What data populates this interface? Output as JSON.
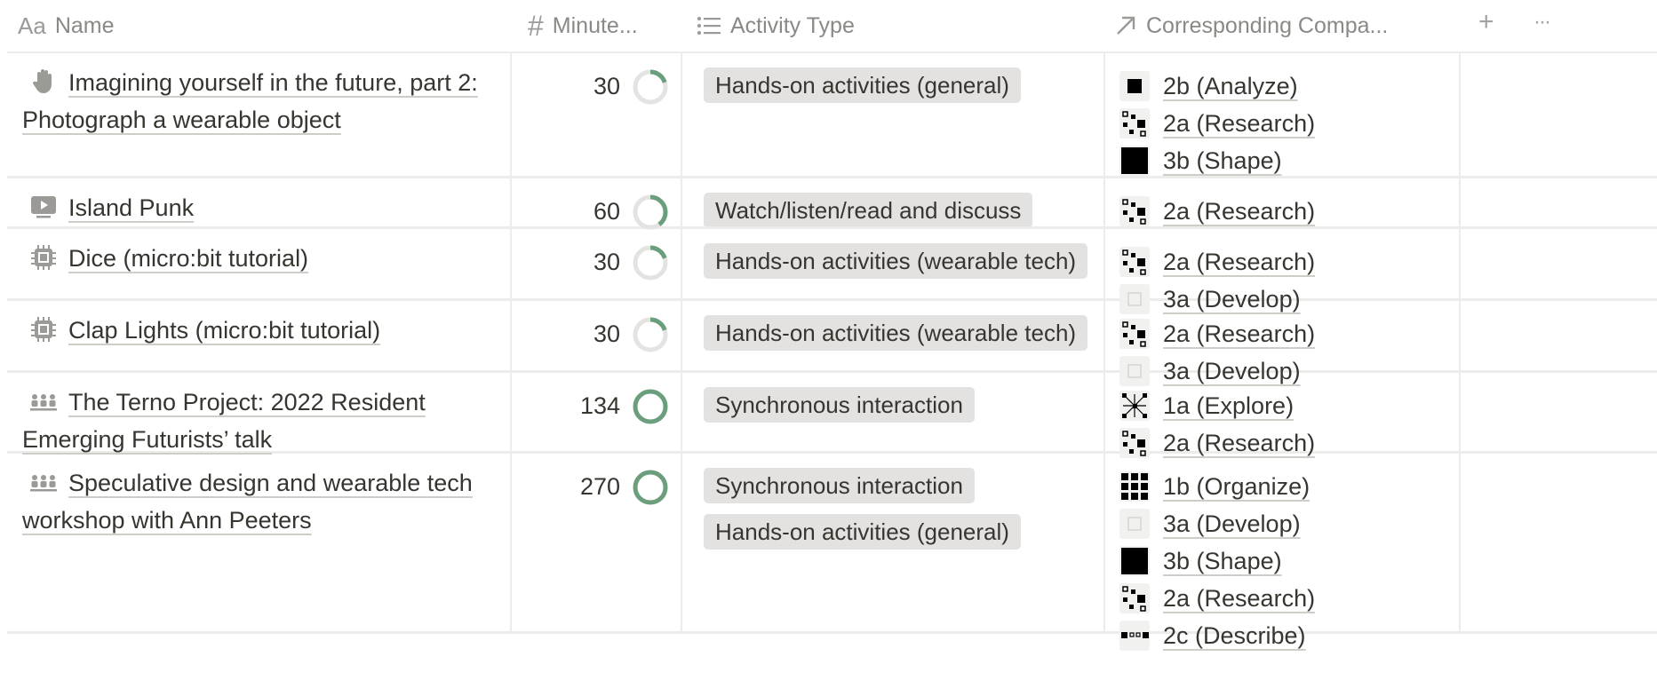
{
  "columns": [
    {
      "icon": "text-type-icon",
      "glyph": "Aa",
      "label": "Name"
    },
    {
      "icon": "number-hash-icon",
      "glyph": "#",
      "label": "Minute..."
    },
    {
      "icon": "list-icon",
      "glyph": "☰",
      "label": "Activity Type"
    },
    {
      "icon": "relation-arrow-icon",
      "glyph": "↗",
      "label": "Corresponding Compa..."
    }
  ],
  "toolbar": {
    "add_glyph": "+",
    "more_glyph": "···"
  },
  "colors": {
    "ring_fill": "#6b9e7c",
    "ring_track": "#e3e3e1",
    "tag_bg": "#e3e2e0"
  },
  "rows": [
    {
      "icon": "hand-icon",
      "name": "Imagining yourself in the future, part 2: Photograph a wearable object",
      "minutes": "30",
      "progress": 0.2,
      "types": [
        "Hands-on activities (general)"
      ],
      "competencies": [
        {
          "icon": "analyze-icon",
          "label": "2b (Analyze)"
        },
        {
          "icon": "research-icon",
          "label": "2a (Research)"
        },
        {
          "icon": "shape-icon",
          "label": "3b (Shape)"
        }
      ]
    },
    {
      "icon": "video-icon",
      "name": "Island Punk",
      "minutes": "60",
      "progress": 0.4,
      "types": [
        "Watch/listen/read and discuss"
      ],
      "competencies": [
        {
          "icon": "research-icon",
          "label": "2a (Research)"
        }
      ]
    },
    {
      "icon": "chip-icon",
      "name": "Dice (micro:bit tutorial)",
      "minutes": "30",
      "progress": 0.2,
      "types": [
        "Hands-on activities (wearable tech)"
      ],
      "competencies": [
        {
          "icon": "research-icon",
          "label": "2a (Research)"
        },
        {
          "icon": "develop-icon",
          "label": "3a (Develop)"
        }
      ]
    },
    {
      "icon": "chip-icon",
      "name": "Clap Lights (micro:bit tutorial)",
      "minutes": "30",
      "progress": 0.2,
      "types": [
        "Hands-on activities (wearable tech)"
      ],
      "competencies": [
        {
          "icon": "research-icon",
          "label": "2a (Research)"
        },
        {
          "icon": "develop-icon",
          "label": "3a (Develop)"
        }
      ]
    },
    {
      "icon": "people-icon",
      "name": "The Terno Project: 2022 Resident Emerging Futurists’ talk",
      "minutes": "134",
      "progress": 1.0,
      "types": [
        "Synchronous interaction"
      ],
      "competencies": [
        {
          "icon": "explore-icon",
          "label": "1a (Explore)"
        },
        {
          "icon": "research-icon",
          "label": "2a (Research)"
        }
      ]
    },
    {
      "icon": "people-icon",
      "name": "Speculative design and wearable tech workshop with Ann Peeters",
      "minutes": "270",
      "progress": 1.0,
      "types": [
        "Synchronous interaction",
        "Hands-on activities (general)"
      ],
      "competencies": [
        {
          "icon": "organize-icon",
          "label": "1b (Organize)"
        },
        {
          "icon": "develop-icon",
          "label": "3a (Develop)"
        },
        {
          "icon": "shape-icon",
          "label": "3b (Shape)"
        },
        {
          "icon": "research-icon",
          "label": "2a (Research)"
        },
        {
          "icon": "describe-icon",
          "label": "2c (Describe)"
        }
      ]
    }
  ]
}
